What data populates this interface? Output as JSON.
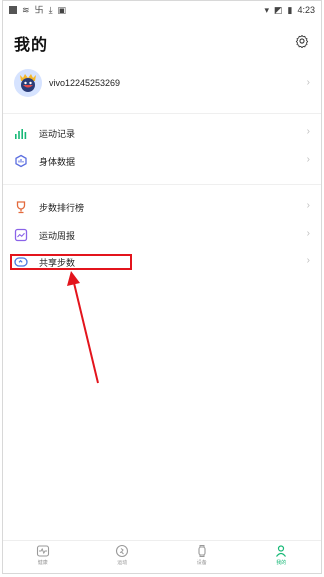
{
  "status_bar": {
    "time": "4:23"
  },
  "header": {
    "title": "我的",
    "settings_icon": "gear-icon"
  },
  "profile": {
    "username": "vivo12245253269"
  },
  "menu_group_1": [
    {
      "label": "运动记录",
      "icon": "bar-chart-icon",
      "icon_color": "#16b876"
    },
    {
      "label": "身体数据",
      "icon": "body-data-icon",
      "icon_color": "#5b6ee0"
    }
  ],
  "menu_group_2": [
    {
      "label": "步数排行榜",
      "icon": "trophy-icon",
      "icon_color": "#e36a3c"
    },
    {
      "label": "运动周报",
      "icon": "weekly-report-icon",
      "icon_color": "#8a63e8"
    },
    {
      "label": "共享步数",
      "icon": "share-steps-icon",
      "icon_color": "#4a78e0"
    }
  ],
  "bottom_nav": [
    {
      "label": "健康",
      "icon": "heart-pulse-icon",
      "active": false
    },
    {
      "label": "运动",
      "icon": "running-icon",
      "active": false
    },
    {
      "label": "设备",
      "icon": "watch-icon",
      "active": false
    },
    {
      "label": "我的",
      "icon": "person-icon",
      "active": true
    }
  ],
  "colors": {
    "accent": "#16b876",
    "highlight": "#e3141c"
  }
}
